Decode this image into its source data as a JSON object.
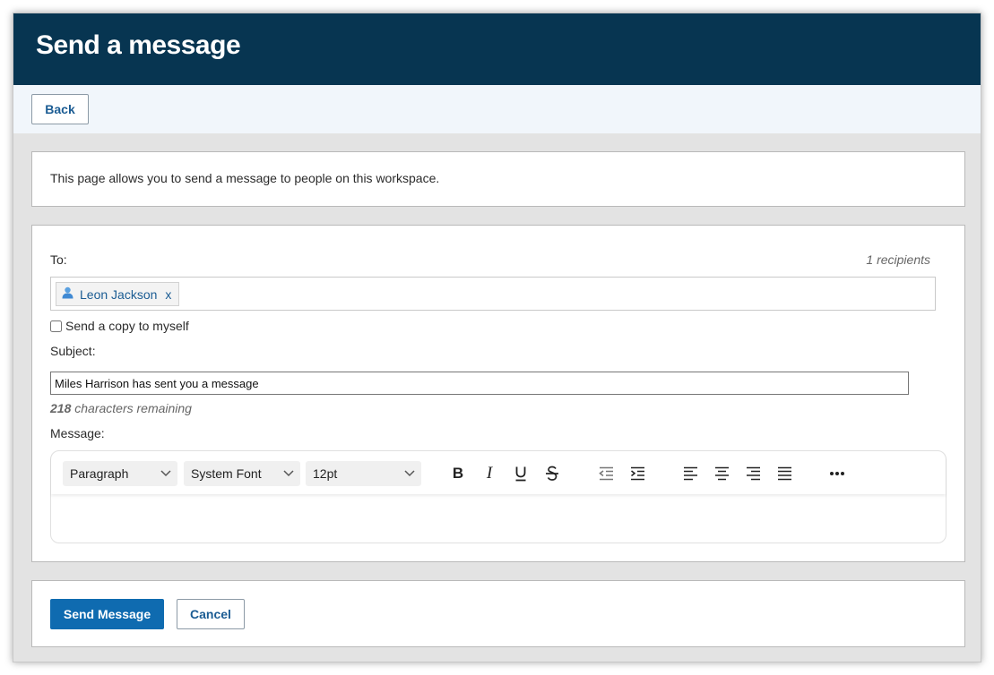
{
  "header": {
    "title": "Send a message"
  },
  "toolbar": {
    "back_label": "Back"
  },
  "info": {
    "text": "This page allows you to send a message to people on this workspace."
  },
  "form": {
    "to_label": "To:",
    "recipients_count": "1 recipients",
    "recipients": [
      {
        "name": "Leon Jackson",
        "remove": "x",
        "icon": "user-icon"
      }
    ],
    "copy_label": "Send a copy to myself",
    "copy_checked": false,
    "subject_label": "Subject:",
    "subject_value": "Miles Harrison has sent you a message",
    "chars_count": "218",
    "chars_text": " characters remaining",
    "message_label": "Message:"
  },
  "editor": {
    "block_format": "Paragraph",
    "font_family": "System Font",
    "font_size": "12pt",
    "icons": [
      "bold-icon",
      "italic-icon",
      "underline-icon",
      "strikethrough-icon",
      "outdent-icon",
      "indent-icon",
      "align-left-icon",
      "align-center-icon",
      "align-right-icon",
      "justify-icon",
      "more-icon"
    ],
    "bold_glyph": "B",
    "italic_glyph": "I"
  },
  "actions": {
    "send_label": "Send Message",
    "cancel_label": "Cancel"
  },
  "colors": {
    "header_bg": "#073551",
    "primary": "#0f6bb0",
    "link": "#1b5c93",
    "toolbar_bg": "#f1f6fb",
    "page_bg": "#e3e3e3"
  }
}
